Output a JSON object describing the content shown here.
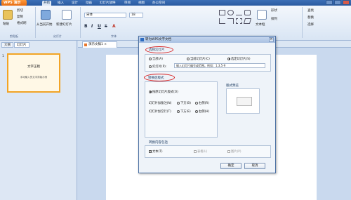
{
  "app": {
    "button_label": "WPS 演示"
  },
  "menu": {
    "tabs": [
      "开始",
      "插入",
      "设计",
      "动画",
      "幻灯片放映",
      "审阅",
      "视图",
      "办公空间"
    ],
    "active_tab": "开始"
  },
  "ribbon": {
    "clipboard": {
      "paste": "粘贴",
      "cut": "剪切",
      "copy": "复制",
      "format_painter": "格式刷",
      "group_label": "剪贴板"
    },
    "slides": {
      "from_current": "从当前开始",
      "new_slide": "新建幻灯片",
      "group_label": "幻灯片"
    },
    "font": {
      "name": "宋体",
      "size": "18",
      "group_label": "字体"
    },
    "drawing": {
      "text_box": "文本框",
      "shapes": "形状",
      "arrange": "排列"
    },
    "editing": {
      "find": "查找",
      "replace": "替换",
      "select": "选择"
    }
  },
  "left_pane": {
    "tabs": [
      "大纲",
      "幻灯片"
    ],
    "active_tab": "幻灯片",
    "slide_number": "1",
    "thumbnail": {
      "title": "文字正稿",
      "subtitle": "手动输入的文字排版示例"
    }
  },
  "doc_tab": {
    "label": "演示文稿1 ×"
  },
  "dialog": {
    "title": "转为WPS文字文档",
    "close": "×",
    "select_slides": {
      "label": "选择幻灯片",
      "options": [
        "全部(A)",
        "当前幻灯片(C)",
        "选定幻灯片(S)"
      ],
      "selected": "选定幻灯片(S)",
      "range_option": "幻灯片(P):",
      "range_hint": "输入幻灯片编号或范围。例如：1,3,5-9"
    },
    "layout": {
      "label": "转换后版式",
      "keep_layout": "按原幻灯片版式(O)",
      "note_on_slide": "幻灯片加备注(N)",
      "below": "下方(B)",
      "right": "右侧(R)",
      "blank_line_after": "幻灯片加空行(T)",
      "below2": "下方(E)",
      "right2": "右侧(H)"
    },
    "preview": {
      "label": "版式预览"
    },
    "content": {
      "label": "转换内容包括",
      "text": "文本(T)",
      "table": "表格(L)",
      "image": "图片(P)"
    },
    "ok": "确定",
    "cancel": "取消"
  }
}
